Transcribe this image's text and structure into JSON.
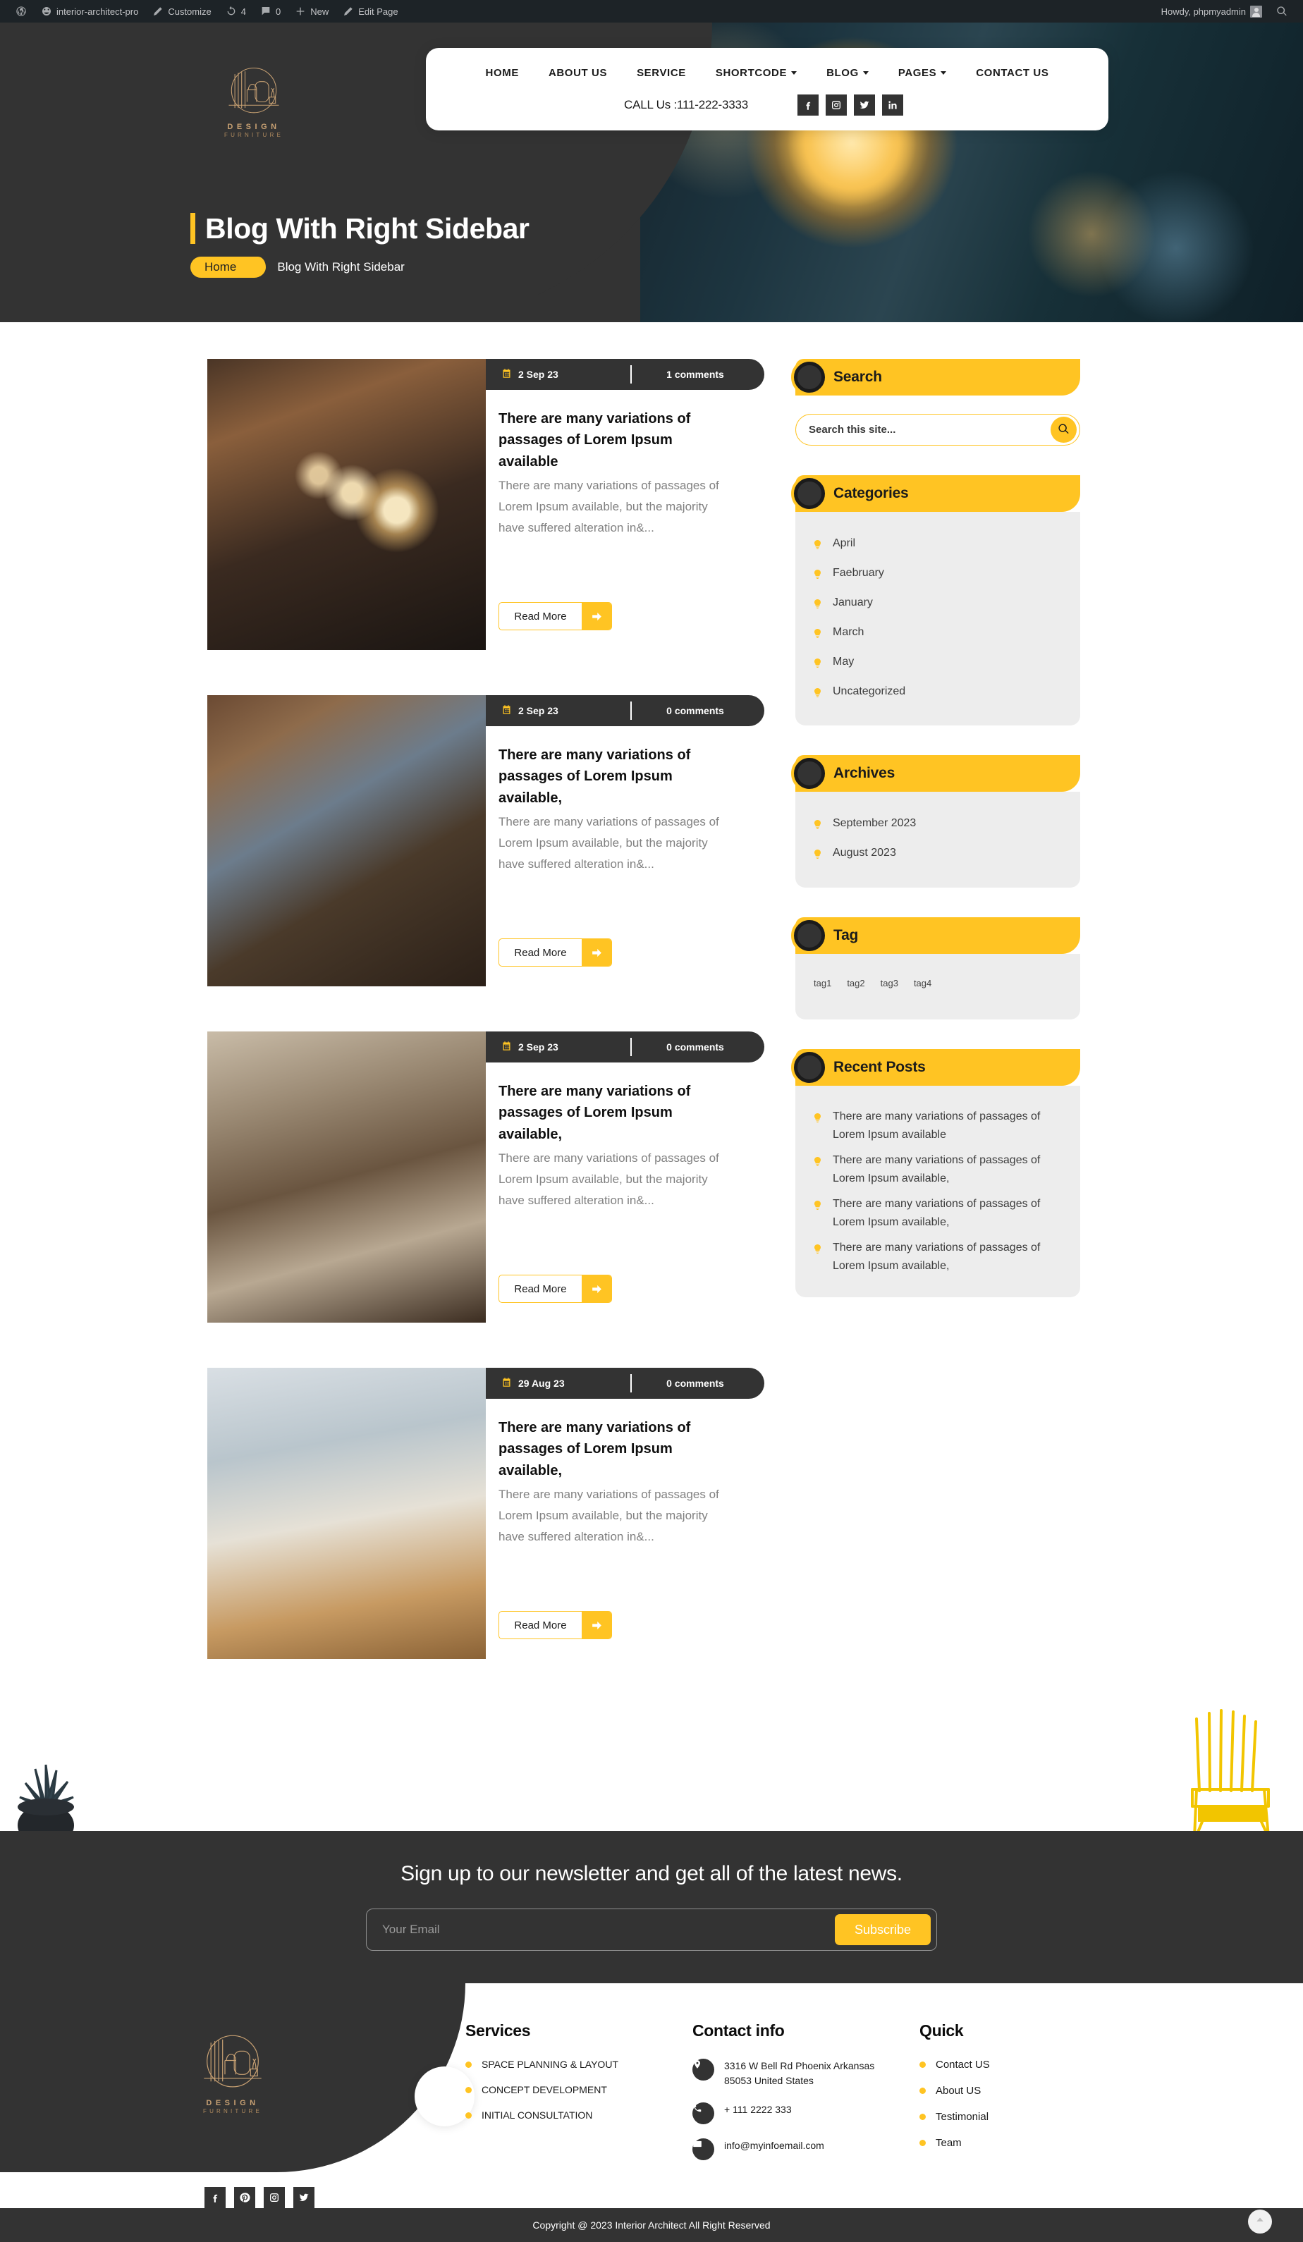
{
  "adminbar": {
    "wp_logo_icon": "wordpress-icon",
    "site_name": "interior-architect-pro",
    "customize": "Customize",
    "updates_count": "4",
    "comments_count": "0",
    "new": "New",
    "edit_page": "Edit Page",
    "howdy": "Howdy, phpmyadmin"
  },
  "logo": {
    "line1": "DESIGN",
    "line2": "FURNITURE"
  },
  "nav": {
    "items": [
      {
        "label": "HOME",
        "has_caret": false
      },
      {
        "label": "ABOUT US",
        "has_caret": false
      },
      {
        "label": "SERVICE",
        "has_caret": false
      },
      {
        "label": "SHORTCODE",
        "has_caret": true
      },
      {
        "label": "BLOG",
        "has_caret": true
      },
      {
        "label": "PAGES",
        "has_caret": true
      },
      {
        "label": "CONTACT US",
        "has_caret": false
      }
    ],
    "call_label": "CALL Us :",
    "call_number": "111-222-3333",
    "socials": [
      "facebook-icon",
      "instagram-icon",
      "twitter-icon",
      "linkedin-icon"
    ]
  },
  "hero": {
    "title": "Blog With Right Sidebar",
    "crumb_home": "Home",
    "crumb_current": "Blog With Right Sidebar"
  },
  "posts": [
    {
      "date": "2 Sep 23",
      "comments": "1 comments",
      "title": "There are many variations of passages of Lorem Ipsum available",
      "excerpt": "There are many variations of passages of Lorem Ipsum available, but the majority have suffered alteration in&...",
      "read_more": "Read More"
    },
    {
      "date": "2 Sep 23",
      "comments": "0 comments",
      "title": "There are many variations of passages of Lorem Ipsum available,",
      "excerpt": "There are many variations of passages of Lorem Ipsum available, but the majority have suffered alteration in&...",
      "read_more": "Read More"
    },
    {
      "date": "2 Sep 23",
      "comments": "0 comments",
      "title": "There are many variations of passages of Lorem Ipsum available,",
      "excerpt": "There are many variations of passages of Lorem Ipsum available, but the majority have suffered alteration in&...",
      "read_more": "Read More"
    },
    {
      "date": "29 Aug 23",
      "comments": "0 comments",
      "title": "There are many variations of passages of Lorem Ipsum available,",
      "excerpt": "There are many variations of passages of Lorem Ipsum available, but the majority have suffered alteration in&...",
      "read_more": "Read More"
    }
  ],
  "sidebar": {
    "search": {
      "title": "Search",
      "placeholder": "Search this site...",
      "value": ""
    },
    "categories": {
      "title": "Categories",
      "items": [
        "April",
        "Faebruary",
        "January",
        "March",
        "May",
        "Uncategorized"
      ]
    },
    "archives": {
      "title": "Archives",
      "items": [
        "September 2023",
        "August 2023"
      ]
    },
    "tag": {
      "title": "Tag",
      "items": [
        "tag1",
        "tag2",
        "tag3",
        "tag4"
      ]
    },
    "recent": {
      "title": "Recent Posts",
      "items": [
        "There are many variations of passages of Lorem Ipsum available",
        "There are many variations of passages of Lorem Ipsum available,",
        "There are many variations of passages of Lorem Ipsum available,",
        "There are many variations of passages of Lorem Ipsum available,"
      ]
    }
  },
  "newsletter": {
    "heading": "Sign up to our newsletter and get all of the latest news.",
    "placeholder": "Your Email",
    "value": "",
    "button": "Subscribe"
  },
  "footer": {
    "services": {
      "title": "Services",
      "items": [
        "SPACE PLANNING & LAYOUT",
        "CONCEPT DEVELOPMENT",
        "INITIAL CONSULTATION"
      ]
    },
    "contact": {
      "title": "Contact info",
      "address": "3316 W Bell Rd Phoenix Arkansas 85053 United States",
      "phone": "+ 111 2222 333",
      "email": "info@myinfoemail.com"
    },
    "quick": {
      "title": "Quick",
      "items": [
        "Contact US",
        "About US",
        "Testimonial",
        "Team"
      ]
    },
    "socials": [
      "facebook-icon",
      "pinterest-icon",
      "instagram-icon",
      "twitter-icon"
    ],
    "copyright": "Copyright @ 2023 Interior Architect All Right Reserved"
  },
  "colors": {
    "accent": "#ffc423",
    "dark": "#333333",
    "panel": "#ededed"
  }
}
